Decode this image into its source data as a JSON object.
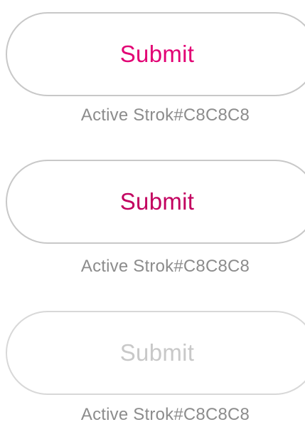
{
  "buttons": [
    {
      "label": "Submit",
      "label_color": "#E20074",
      "stroke_color": "#C8C8C8",
      "caption": "Active  Strok#C8C8C8"
    },
    {
      "label": "Submit",
      "label_color": "#C2005F",
      "stroke_color": "#C8C8C8",
      "caption": "Active  Strok#C8C8C8"
    },
    {
      "label": "Submit",
      "label_color": "#C8C8C8",
      "stroke_color": "#D8D8D8",
      "caption": "Active  Strok#C8C8C8"
    }
  ],
  "caption_color": "#8C8C8C",
  "background_color": "#FFFFFF"
}
